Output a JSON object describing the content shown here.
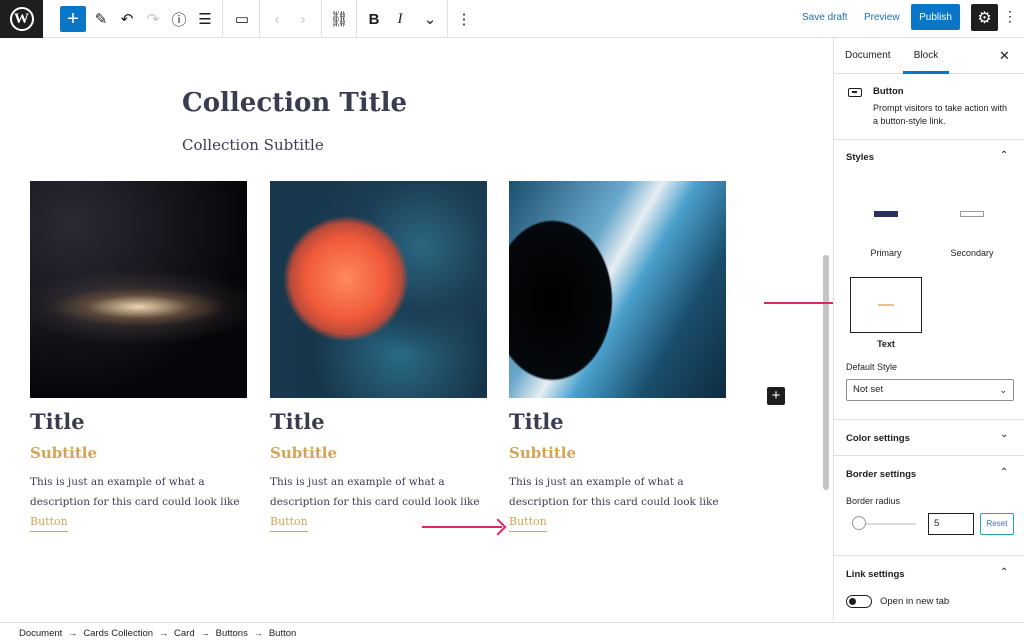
{
  "toolbar": {
    "add_icon": "plus-icon",
    "save_draft": "Save draft",
    "preview": "Preview",
    "publish": "Publish"
  },
  "content": {
    "collection_title": "Collection Title",
    "collection_subtitle": "Collection Subtitle",
    "cards": [
      {
        "title": "Title",
        "subtitle": "Subtitle",
        "description": "This is just an example of what a description for this card could look like",
        "button": "Button"
      },
      {
        "title": "Title",
        "subtitle": "Subtitle",
        "description": "This is just an example of what a description for this card could look like",
        "button": "Button"
      },
      {
        "title": "Title",
        "subtitle": "Subtitle",
        "description": "This is just an example of what a description for this card could look like",
        "button": "Button"
      }
    ]
  },
  "sidebar": {
    "tabs": [
      "Document",
      "Block"
    ],
    "active_tab": "Block",
    "block_name": "Button",
    "block_description": "Prompt visitors to take action with a button-style link.",
    "styles": {
      "heading": "Styles",
      "options": [
        "Primary",
        "Secondary",
        "Text"
      ],
      "selected": "Text"
    },
    "default_style": {
      "label": "Default Style",
      "value": "Not set"
    },
    "color_settings": "Color settings",
    "border_settings": {
      "heading": "Border settings",
      "radius_label": "Border radius",
      "radius_value": "5",
      "reset": "Reset"
    },
    "link_settings": {
      "heading": "Link settings",
      "toggle_label": "Open in new tab"
    }
  },
  "breadcrumb": [
    "Document",
    "Cards Collection",
    "Card",
    "Buttons",
    "Button"
  ],
  "colors": {
    "accent": "#0a76c7",
    "heading": "#3a3d52",
    "gold": "#d4a454",
    "annotation_arrow": "#e0256a"
  }
}
